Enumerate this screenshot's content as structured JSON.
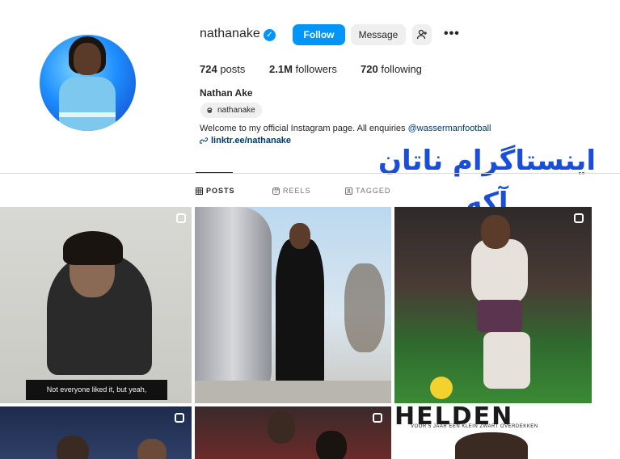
{
  "profile": {
    "username": "nathanake",
    "verified_icon": "verified-badge-icon",
    "follow_label": "Follow",
    "message_label": "Message",
    "more_label": "•••",
    "full_name": "Nathan Ake",
    "threads_handle": "nathanake",
    "bio_text": "Welcome to my official Instagram page. All enquiries ",
    "bio_mention": "@wassermanfootball",
    "link": "linktr.ee/nathanake"
  },
  "stats": {
    "posts_count": "724",
    "posts_label": "posts",
    "followers_count": "2.1M",
    "followers_label": "followers",
    "following_count": "720",
    "following_label": "following"
  },
  "overlay": {
    "title": "اینستاگرام ناتان آکه"
  },
  "tabs": [
    {
      "label": "POSTS",
      "icon": "grid-icon",
      "active": true
    },
    {
      "label": "REELS",
      "icon": "reels-icon",
      "active": false
    },
    {
      "label": "TAGGED",
      "icon": "tagged-icon",
      "active": false
    }
  ],
  "posts": {
    "post1_caption": "Not everyone liked it, but yeah,",
    "post6_text": "HELDEN",
    "post6_subtext": "VOOR 5 JAAR EEN KLEIN ZWART OVERDEKKEN"
  },
  "colors": {
    "accent": "#0095f6",
    "link": "#00376b",
    "overlay": "#1a4ed6"
  }
}
